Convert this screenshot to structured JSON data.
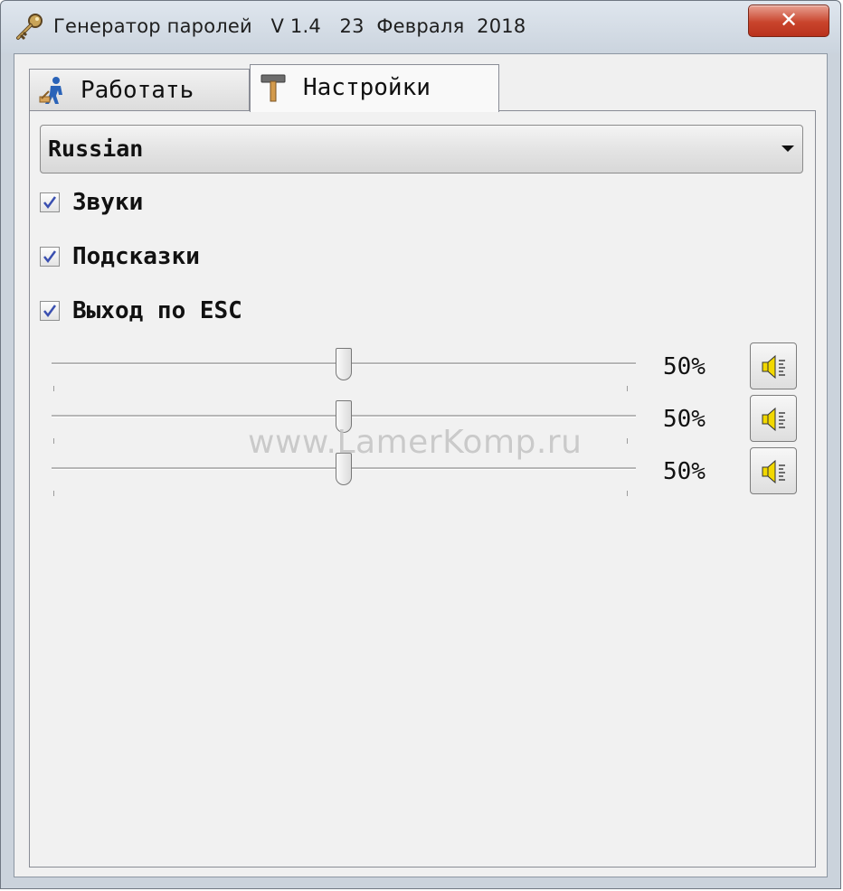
{
  "window": {
    "title": "Генератор паролей   V 1.4   23  Февраля  2018",
    "close_label": "✕"
  },
  "tabs": [
    {
      "label": "Работать",
      "icon": "worker-icon",
      "active": false
    },
    {
      "label": "Настройки",
      "icon": "hammer-icon",
      "active": true
    }
  ],
  "settings": {
    "language": {
      "selected": "Russian"
    },
    "checkboxes": [
      {
        "label": "Звуки",
        "checked": true
      },
      {
        "label": "Подсказки",
        "checked": true
      },
      {
        "label": "Выход по ESC",
        "checked": true
      }
    ],
    "sliders": [
      {
        "value": 50,
        "value_label": "50%",
        "button_icon": "speaker-icon"
      },
      {
        "value": 50,
        "value_label": "50%",
        "button_icon": "speaker-icon"
      },
      {
        "value": 50,
        "value_label": "50%",
        "button_icon": "speaker-icon"
      }
    ]
  },
  "watermark": "www.LamerKomp.ru",
  "colors": {
    "close_button": "#c9442c",
    "window_frame": "#cbd3dc",
    "check_mark": "#3a4fb0",
    "speaker": "#f2d800"
  }
}
